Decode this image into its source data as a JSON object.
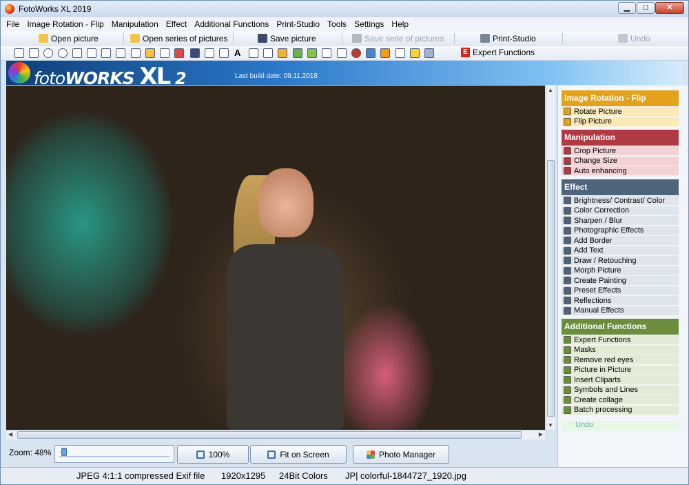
{
  "window": {
    "title": "FotoWorks XL 2019",
    "btn_min": "▁",
    "btn_max": "□",
    "btn_close": "✕"
  },
  "menu": [
    "File",
    "Image Rotation - Flip",
    "Manipulation",
    "Effect",
    "Additional Functions",
    "Print-Studio",
    "Tools",
    "Settings",
    "Help"
  ],
  "toolbar": {
    "open_picture": "Open picture",
    "open_series": "Open series of pictures",
    "save_picture": "Save picture",
    "save_serie": "Save serie of pictures",
    "print_studio": "Print-Studio",
    "undo": "Undo",
    "expert_functions": "Expert Functions",
    "expert_badge": "E"
  },
  "banner": {
    "brand_a": "foto",
    "brand_b": "WORKS",
    "brand_c": "XL",
    "brand_d": "2",
    "build": "Last build date: 09.11.2018"
  },
  "zoom": {
    "label": "Zoom: 48%",
    "value_percent": 48
  },
  "buttons": {
    "hundred": "100%",
    "fit": "Fit on Screen",
    "manager": "Photo Manager"
  },
  "status": {
    "format": "JPEG 4:1:1 compressed Exif file",
    "dims": "1920x1295",
    "colors": "24Bit Colors",
    "type": "JP|",
    "file": "colorful-1844727_1920.jpg"
  },
  "panel": {
    "rotation": {
      "title": "Image Rotation - Flip",
      "color": "#e4a21c",
      "item_color": "#fbe9b8",
      "items": [
        "Rotate Picture",
        "Flip Picture"
      ]
    },
    "manipulation": {
      "title": "Manipulation",
      "color": "#b03a44",
      "item_color": "#f3d2d4",
      "items": [
        "Crop Picture",
        "Change Size",
        "Auto enhancing"
      ]
    },
    "effect": {
      "title": "Effect",
      "color": "#4f6379",
      "item_color": "#dfe5ed",
      "items": [
        "Brightness/ Contrast/ Color",
        "Color Correction",
        "Sharpen / Blur",
        "Photographic Effects",
        "Add Border",
        "Add Text",
        "Draw / Retouching",
        "Morph Picture",
        "Create Painting",
        "Preset Effects",
        "Reflections",
        "Manual Effects"
      ]
    },
    "additional": {
      "title": "Additional Functions",
      "color": "#6a8e3e",
      "item_color": "#e2ebd6",
      "items": [
        "Expert Functions",
        "Masks",
        "Remove red eyes",
        "Picture in Picture",
        "Insert Cliparts",
        "Symbols and Lines",
        "Create collage",
        "Batch processing"
      ]
    },
    "undo": "Undo"
  }
}
